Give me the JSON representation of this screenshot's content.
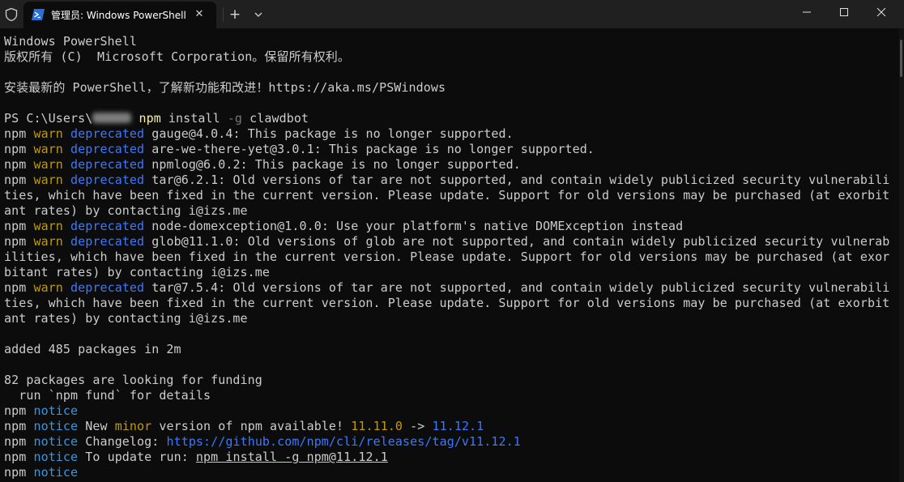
{
  "titlebar": {
    "tab_title": "管理员: Windows PowerShell",
    "close_tab_glyph": "✕",
    "new_tab_glyph": "+",
    "icons": {
      "admin": "shield-icon",
      "tab": "powershell-icon",
      "dropdown": "chevron-down-icon",
      "minimize": "minimize-icon",
      "maximize": "maximize-icon",
      "close": "close-icon"
    }
  },
  "colors": {
    "background": "#0c0c0c",
    "titlebar": "#202020",
    "text": "#cccccc",
    "warn": "#c19c00",
    "deprecated": "#3b78ff",
    "notice": "#3a96dd",
    "command": "#f9f1a5"
  },
  "terminal": {
    "header1": "Windows PowerShell",
    "header2": "版权所有 (C)  Microsoft Corporation。保留所有权利。",
    "header3": "安装最新的 PowerShell，了解新功能和改进！https://aka.ms/PSWindows",
    "prompt": "PS C:\\Users\\",
    "prompt_end": " ",
    "cmd": "npm",
    "cmd_args1": " install ",
    "cmd_flag": "-g",
    "cmd_args2": " clawdbot",
    "npm": "npm",
    "warn": "warn",
    "deprecated": "deprecated",
    "notice": "notice",
    "minor": "minor",
    "w1": " gauge@4.0.4: This package is no longer supported.",
    "w2": " are-we-there-yet@3.0.1: This package is no longer supported.",
    "w3": " npmlog@6.0.2: This package is no longer supported.",
    "w4a": " tar@6.2.1: Old versions of tar are not supported, and contain widely publicized security vulnerabili",
    "w4b": "ties, which have been fixed in the current version. Please update. Support for old versions may be purchased (at exorbit",
    "w4c": "ant rates) by contacting i@izs.me",
    "w5": " node-domexception@1.0.0: Use your platform's native DOMException instead",
    "w6a": " glob@11.1.0: Old versions of glob are not supported, and contain widely publicized security vulnerab",
    "w6b": "ilities, which have been fixed in the current version. Please update. Support for old versions may be purchased (at exor",
    "w6c": "bitant rates) by contacting i@izs.me",
    "w7a": " tar@7.5.4: Old versions of tar are not supported, and contain widely publicized security vulnerabili",
    "w7b": "ties, which have been fixed in the current version. Please update. Support for old versions may be purchased (at exorbit",
    "w7c": "ant rates) by contacting i@izs.me",
    "added": "added 485 packages in 2m",
    "funding1": "82 packages are looking for funding",
    "funding2": "  run `npm fund` for details",
    "n2_pre": " New ",
    "n2_mid": " version of npm available! ",
    "old_version": "11.11.0",
    "arrow": " -> ",
    "new_version": "11.12.1",
    "n3_pre": " Changelog: ",
    "changelog_url": "https://github.com/npm/cli/releases/tag/v11.12.1",
    "n4_pre": " To update run: ",
    "update_cmd": "npm install -g npm@11.12.1"
  }
}
